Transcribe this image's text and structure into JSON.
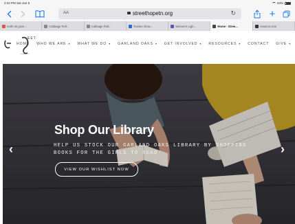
{
  "statusbar": {
    "time": "2:22 PM",
    "date": "Sat Jan 9",
    "battery": "63%"
  },
  "toolbar": {
    "back_icon": "chevron-left-icon",
    "forward_icon": "chevron-right-icon",
    "aa_label": "AA",
    "url": "streethopetn.org",
    "reload_icon": "reload-icon",
    "share_icon": "share-icon",
    "new_tab_icon": "plus-icon",
    "tabs_icon": "tabs-overview-icon"
  },
  "tabs": [
    {
      "label": "north ok gove...",
      "color": "#d9534f",
      "active": false
    },
    {
      "label": "Cabbage Roll...",
      "color": "#888888",
      "active": false
    },
    {
      "label": "Cabbage Roll...",
      "color": "#888888",
      "active": false
    },
    {
      "label": "Tracker show...",
      "color": "#2b6cc4",
      "active": false
    },
    {
      "label": "Women's Ligh...",
      "color": "#6a4fb3",
      "active": false
    },
    {
      "label": "Home - Stree...",
      "color": "#444444",
      "active": true
    },
    {
      "label": "Amazon.com",
      "color": "#333333",
      "active": false
    }
  ],
  "site": {
    "logo_text": "Street Hope",
    "nav": [
      {
        "label": "HOME",
        "caret": false
      },
      {
        "label": "WHO WE ARE",
        "caret": true
      },
      {
        "label": "WHAT WE DO",
        "caret": true
      },
      {
        "label": "GARLAND OAKS",
        "caret": true
      },
      {
        "label": "GET INVOLVED",
        "caret": true
      },
      {
        "label": "RESOURCES",
        "caret": true
      },
      {
        "label": "CONTACT",
        "caret": false
      },
      {
        "label": "GIVE",
        "caret": true
      }
    ]
  },
  "hero": {
    "title": "Shop Our Library",
    "subtitle": "HELP US STOCK OUR GARLAND OAKS LIBRARY BY SHOPPING BOOKS FOR THE GIRLS TO READ",
    "button_label": "VIEW OUR WISHLIST NOW",
    "prev_label": "‹",
    "next_label": "›"
  }
}
